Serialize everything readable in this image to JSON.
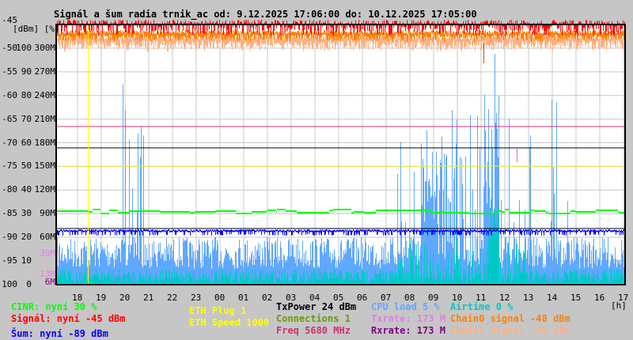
{
  "chart_data": {
    "type": "line",
    "title": "Signál a šum radia trnik_ac od: 9.12.2025 17:06:00 do: 10.12.2025 17:05:00",
    "y_units_label": "[dBm] [%]",
    "y_ticks": [
      {
        "dbm": "-45",
        "pct": "",
        "rate": ""
      },
      {
        "dbm": "-50",
        "pct": "100",
        "rate": "300M"
      },
      {
        "dbm": "-55",
        "pct": "90",
        "rate": "270M"
      },
      {
        "dbm": "-60",
        "pct": "80",
        "rate": "240M"
      },
      {
        "dbm": "-65",
        "pct": "70",
        "rate": "210M"
      },
      {
        "dbm": "-70",
        "pct": "60",
        "rate": "180M"
      },
      {
        "dbm": "-75",
        "pct": "50",
        "rate": "150M"
      },
      {
        "dbm": "-80",
        "pct": "40",
        "rate": "120M"
      },
      {
        "dbm": "-85",
        "pct": "30",
        "rate": "90M"
      },
      {
        "dbm": "-90",
        "pct": "20",
        "rate": "60M"
      },
      {
        "dbm": "-95",
        "pct": "10",
        "rate": ""
      },
      {
        "dbm": "-100",
        "pct": "0",
        "rate": ""
      }
    ],
    "extra_rate_labels": [
      {
        "text": "39M",
        "color": "#e080e0"
      },
      {
        "text": "13M",
        "color": "#e080e0"
      },
      {
        "text": "6M",
        "color": "#800080"
      }
    ],
    "ylim_dbm": [
      -100,
      -45
    ],
    "x_ticks": [
      "18",
      "19",
      "20",
      "21",
      "22",
      "23",
      "00",
      "01",
      "02",
      "03",
      "04",
      "05",
      "06",
      "07",
      "08",
      "09",
      "10",
      "11",
      "12",
      "13",
      "14",
      "15",
      "16",
      "17"
    ],
    "x_unit": "[h]",
    "series": [
      {
        "name": "Signál",
        "color": "#ff0000",
        "typical_dbm": -46
      },
      {
        "name": "Chain0 signal",
        "color": "#ff8000",
        "typical_dbm": -48
      },
      {
        "name": "Chain1 signal",
        "color": "#ffb080",
        "typical_dbm": -49
      },
      {
        "name": "CINR",
        "color": "#00ff00",
        "typical_pct": 30
      },
      {
        "name": "Šum",
        "color": "#0000ff",
        "typical_dbm": -89
      },
      {
        "name": "CPU load",
        "color": "#60a8ff",
        "typical_pct": 5
      },
      {
        "name": "Airtime",
        "color": "#00c8c8",
        "typical_pct": 2
      }
    ],
    "reference_lines": [
      {
        "name": "Txrate",
        "color": "#e03080",
        "value_m": 183
      },
      {
        "name": "Rxrate",
        "color": "#800080",
        "value_m": 173
      },
      {
        "name": "ETH Speed",
        "color": "#ffff00",
        "value_m": 150
      },
      {
        "name": "noise-level",
        "color": "#000000",
        "value_dbm": -88.5
      }
    ]
  },
  "legend": {
    "cinr": "CINR: nyní 30 %",
    "signal": "Signál: nyní -45 dBm",
    "noise": "Šum: nyní -89 dBm",
    "eth_plug": "ETH Plug 1",
    "eth_speed": "ETH Speed 1000",
    "txpower": "TxPower 24 dBm",
    "connections": "Connections 1",
    "freq": "Freq 5680 MHz",
    "cpu": "CPU load 5 %",
    "txrate": "Txrate: 173 M",
    "rxrate": "Rxrate: 173 M",
    "airtime": "Airtime 0 %",
    "chain0": "Chain0 signal -48 dBm",
    "chain1": "Chain1 signal -48 dBm"
  },
  "colors": {
    "cinr": "#00ff00",
    "signal": "#ff0000",
    "noise": "#0000ff",
    "eth": "#ffff00",
    "txpower": "#000000",
    "connections": "#6a9a00",
    "freq": "#d03070",
    "cpu": "#60a8ff",
    "txrate": "#e080e0",
    "rxrate": "#800080",
    "airtime": "#00c8c8",
    "chain0": "#ff8000",
    "chain1": "#ffb080"
  }
}
